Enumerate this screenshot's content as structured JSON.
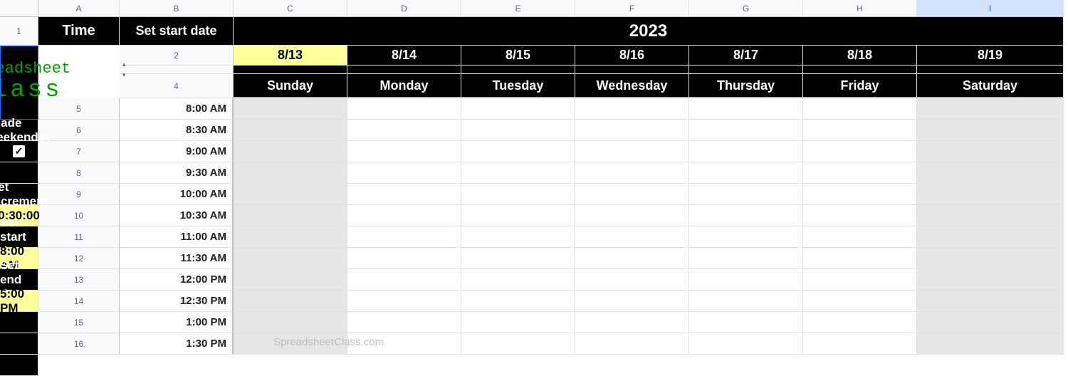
{
  "columns": [
    "A",
    "B",
    "C",
    "D",
    "E",
    "F",
    "G",
    "H",
    "I"
  ],
  "rows_visible": [
    "1",
    "2",
    "",
    "4",
    "5",
    "6",
    "7",
    "8",
    "9",
    "10",
    "11",
    "12",
    "13",
    "14",
    "15",
    "16"
  ],
  "header": {
    "time_label": "Time",
    "set_start_date": "Set start date",
    "year": "2023",
    "dates": [
      "8/13",
      "8/14",
      "8/15",
      "8/16",
      "8/17",
      "8/18",
      "8/19"
    ],
    "days": [
      "Sunday",
      "Monday",
      "Tuesday",
      "Wednesday",
      "Thursday",
      "Friday",
      "Saturday"
    ]
  },
  "times": [
    "8:00 AM",
    "8:30 AM",
    "9:00 AM",
    "9:30 AM",
    "10:00 AM",
    "10:30 AM",
    "11:00 AM",
    "11:30 AM",
    "12:00 PM",
    "12:30 PM",
    "1:00 PM",
    "1:30 PM"
  ],
  "logo": {
    "line1": "Spreadsheet",
    "line2": "Class"
  },
  "sidebar": {
    "shade_weekends_label": "Shade Weekends?",
    "shade_weekends_checked": true,
    "set_increment_label": "Set increment",
    "increment_value": "0:30:00",
    "set_start_time_label": "Set start time",
    "start_time_value": "8:00 AM",
    "set_end_time_label": "Set end time",
    "end_time_value": "5:00 PM"
  },
  "watermark": "SpreadsheetClass.com",
  "checkmark": "✓"
}
